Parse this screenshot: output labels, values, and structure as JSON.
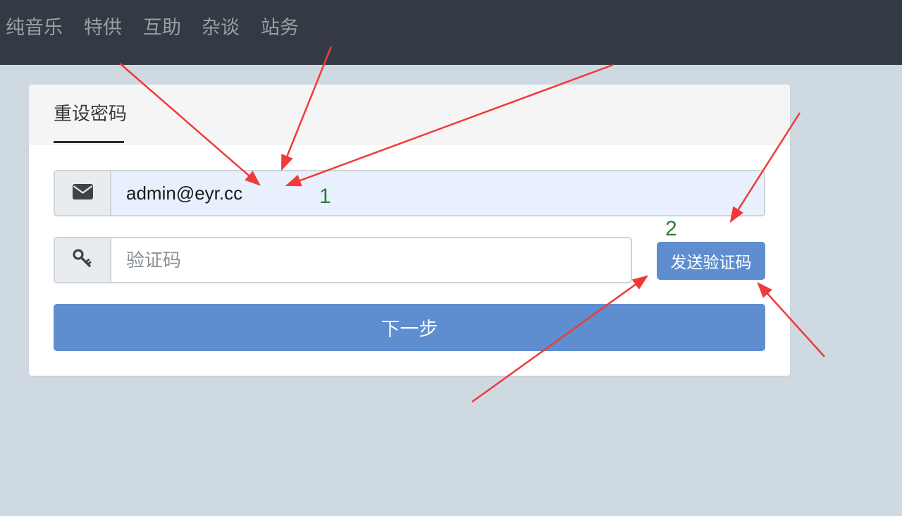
{
  "nav": {
    "items": [
      "纯音乐",
      "特供",
      "互助",
      "杂谈",
      "站务"
    ]
  },
  "card": {
    "tab_title": "重设密码",
    "email": {
      "icon": "envelope-icon",
      "value": "admin@eyr.cc"
    },
    "code": {
      "icon": "key-icon",
      "placeholder": "验证码"
    },
    "send_code_label": "发送验证码",
    "next_label": "下一步"
  },
  "annotations": {
    "label_1": "1",
    "label_2": "2",
    "arrow_color": "#f03a3a"
  },
  "colors": {
    "navbar_bg": "#343a43",
    "page_bg": "#cfd9e2",
    "primary": "#5e8ecf",
    "autofill_bg": "#e8f0fd"
  }
}
